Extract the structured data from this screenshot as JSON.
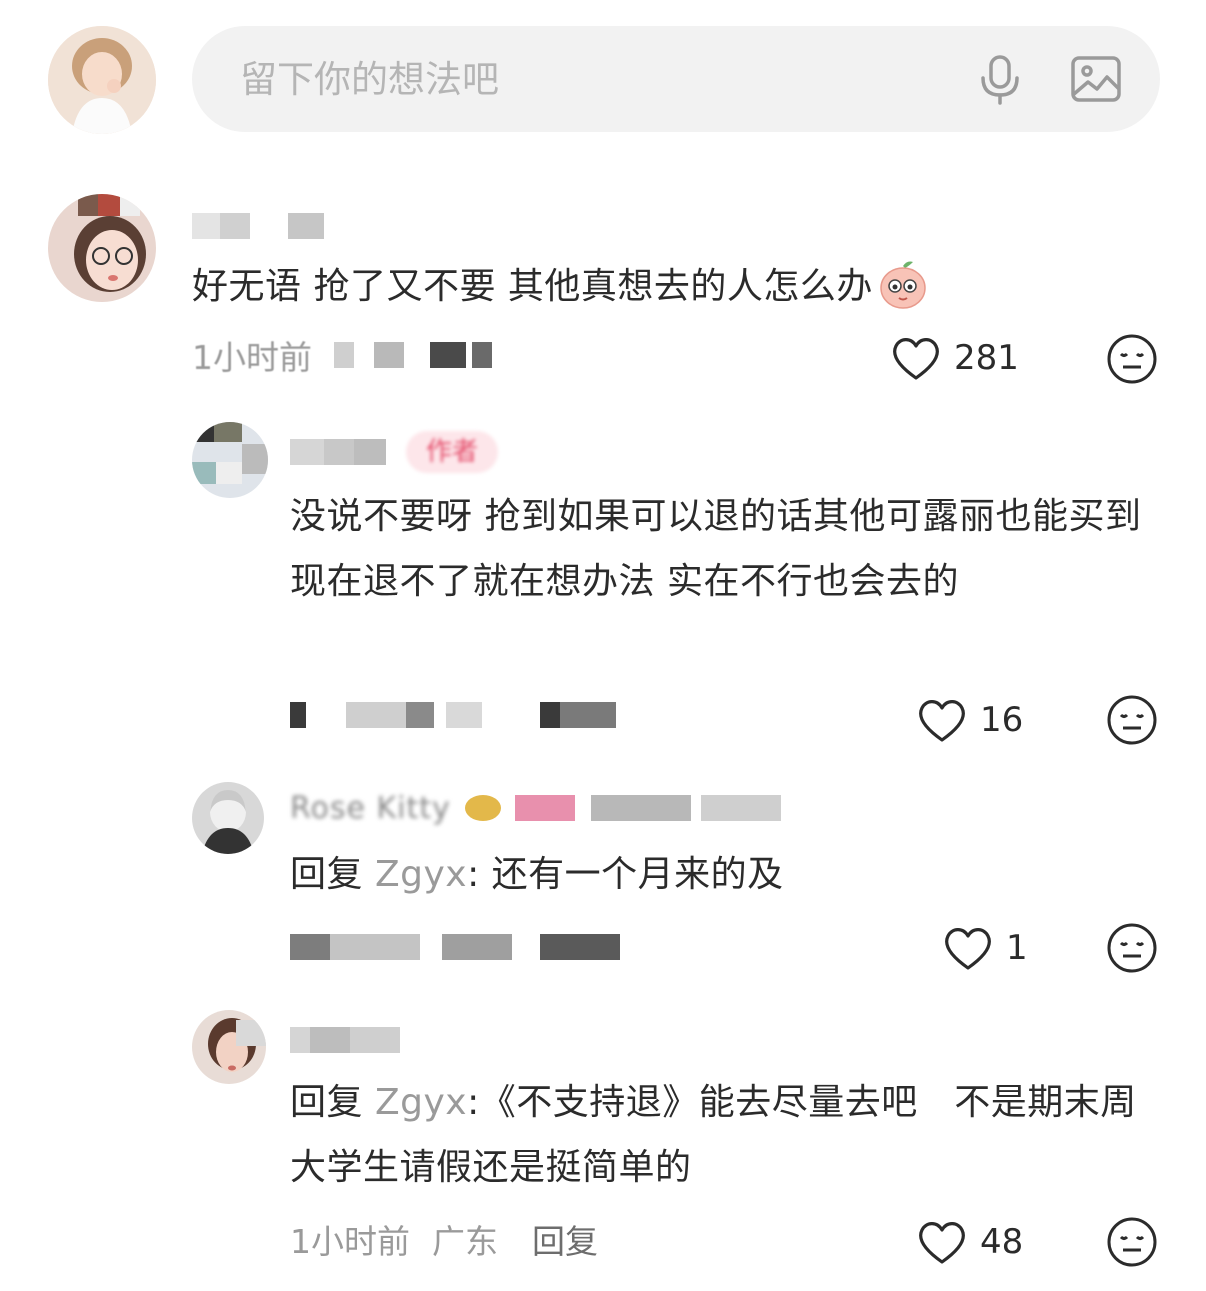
{
  "composer": {
    "placeholder": "留下你的想法吧",
    "mic_icon": "microphone-icon",
    "image_icon": "image-icon"
  },
  "comments": [
    {
      "text": "好无语 抢了又不要 其他真想去的人怎么办",
      "emoji_icon": "peach-face-emoji",
      "meta": "1小时前",
      "likes": "281"
    },
    {
      "author_tag": "作者",
      "text": "没说不要呀 抢到如果可以退的话其他可露丽也能买到现在退不了就在想办法 实在不行也会去的",
      "likes": "16"
    },
    {
      "name": "Rose Kitty",
      "reply_prefix": "回复 ",
      "reply_target": "Zgyx",
      "reply_text": ": 还有一个月来的及",
      "likes": "1"
    },
    {
      "reply_prefix": "回复 ",
      "reply_target": "Zgyx",
      "reply_text": ":《不支持退》能去尽量去吧　不是期末周 大学生请假还是挺简单的",
      "time": "1小时前",
      "location": "广东",
      "reply_label": "回复",
      "likes": "48"
    }
  ],
  "colors": {
    "text": "#2b2b2b",
    "muted": "#9a9a9a",
    "author_tag_bg": "#fde6ea",
    "author_tag_fg": "#e44a68",
    "input_bg": "#f2f2f2"
  }
}
